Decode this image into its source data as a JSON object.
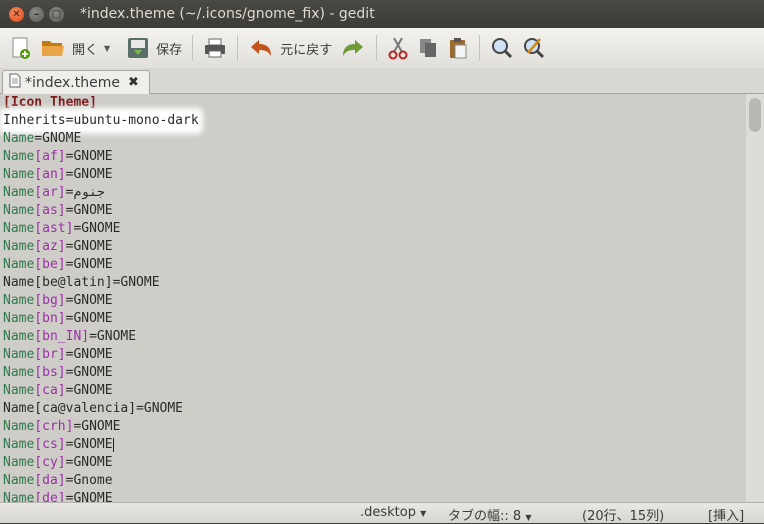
{
  "window": {
    "title": "*index.theme (~/.icons/gnome_fix) - gedit"
  },
  "toolbar": {
    "open_label": "開く",
    "save_label": "保存",
    "undo_label": "元に戻す"
  },
  "tab": {
    "name": "*index.theme"
  },
  "editor": {
    "lines": [
      [
        [
          "[Icon Theme]",
          "sec"
        ]
      ],
      [
        [
          "Inherits=ubuntu-mono-dark",
          "hl"
        ]
      ],
      [
        [
          "Name",
          "k"
        ],
        [
          "=GNOME",
          ""
        ]
      ],
      [
        [
          "Name",
          "k"
        ],
        [
          "[af]",
          "b"
        ],
        [
          "=GNOME",
          ""
        ]
      ],
      [
        [
          "Name",
          "k"
        ],
        [
          "[an]",
          "b"
        ],
        [
          "=GNOME",
          ""
        ]
      ],
      [
        [
          "Name",
          "k"
        ],
        [
          "[ar]",
          "b"
        ],
        [
          "=جنوم",
          ""
        ]
      ],
      [
        [
          "Name",
          "k"
        ],
        [
          "[as]",
          "b"
        ],
        [
          "=GNOME",
          ""
        ]
      ],
      [
        [
          "Name",
          "k"
        ],
        [
          "[ast]",
          "b"
        ],
        [
          "=GNOME",
          ""
        ]
      ],
      [
        [
          "Name",
          "k"
        ],
        [
          "[az]",
          "b"
        ],
        [
          "=GNOME",
          ""
        ]
      ],
      [
        [
          "Name",
          "k"
        ],
        [
          "[be]",
          "b"
        ],
        [
          "=GNOME",
          ""
        ]
      ],
      [
        [
          "Name[be@latin]=GNOME",
          ""
        ]
      ],
      [
        [
          "Name",
          "k"
        ],
        [
          "[bg]",
          "b"
        ],
        [
          "=GNOME",
          ""
        ]
      ],
      [
        [
          "Name",
          "k"
        ],
        [
          "[bn]",
          "b"
        ],
        [
          "=GNOME",
          ""
        ]
      ],
      [
        [
          "Name",
          "k"
        ],
        [
          "[bn_IN]",
          "b"
        ],
        [
          "=GNOME",
          ""
        ]
      ],
      [
        [
          "Name",
          "k"
        ],
        [
          "[br]",
          "b"
        ],
        [
          "=GNOME",
          ""
        ]
      ],
      [
        [
          "Name",
          "k"
        ],
        [
          "[bs]",
          "b"
        ],
        [
          "=GNOME",
          ""
        ]
      ],
      [
        [
          "Name",
          "k"
        ],
        [
          "[ca]",
          "b"
        ],
        [
          "=GNOME",
          ""
        ]
      ],
      [
        [
          "Name[ca@valencia]=GNOME",
          ""
        ]
      ],
      [
        [
          "Name",
          "k"
        ],
        [
          "[crh]",
          "b"
        ],
        [
          "=GNOME",
          ""
        ]
      ],
      [
        [
          "Name",
          "k"
        ],
        [
          "[cs]",
          "b"
        ],
        [
          "=GNOME",
          ""
        ],
        [
          "",
          "cursor"
        ]
      ],
      [
        [
          "Name",
          "k"
        ],
        [
          "[cy]",
          "b"
        ],
        [
          "=GNOME",
          ""
        ]
      ],
      [
        [
          "Name",
          "k"
        ],
        [
          "[da]",
          "b"
        ],
        [
          "=Gnome",
          ""
        ]
      ],
      [
        [
          "Name",
          "k"
        ],
        [
          "[de]",
          "b"
        ],
        [
          "=GNOME",
          ""
        ]
      ]
    ]
  },
  "statusbar": {
    "filetype": ".desktop",
    "tabwidth": "タブの幅:: 8",
    "position": "(20行、15列)",
    "mode": "[挿入]"
  }
}
